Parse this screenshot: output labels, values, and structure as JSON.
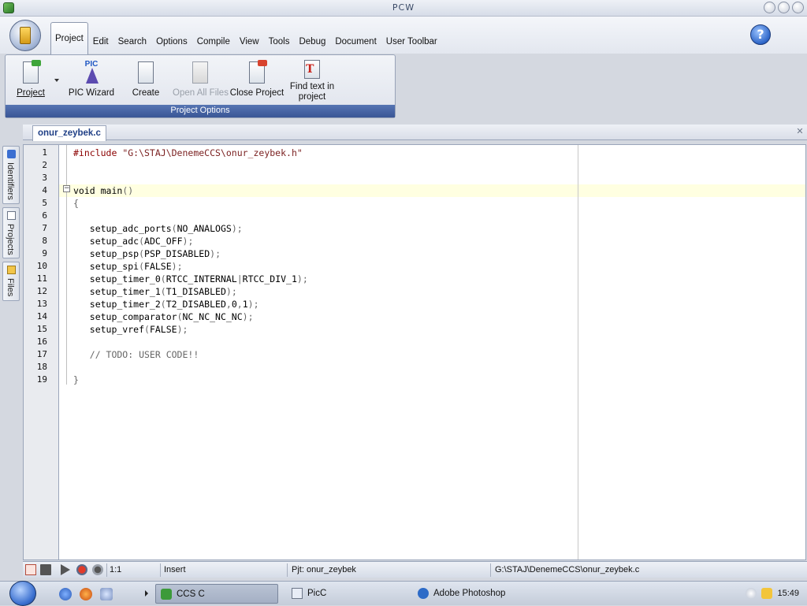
{
  "window": {
    "title": "PCW"
  },
  "menu": {
    "items": [
      "Project",
      "Edit",
      "Search",
      "Options",
      "Compile",
      "View",
      "Tools",
      "Debug",
      "Document",
      "User Toolbar"
    ],
    "active": "Project"
  },
  "ribbon": {
    "buttons": [
      {
        "label": "Project",
        "enabled": true
      },
      {
        "label": "PIC Wizard",
        "enabled": true
      },
      {
        "label": "Create",
        "enabled": true
      },
      {
        "label": "Open All Files",
        "enabled": false
      },
      {
        "label": "Close Project",
        "enabled": true
      },
      {
        "label": "Find text in project",
        "line1": "Find text in",
        "line2": "project",
        "enabled": true
      }
    ],
    "group_label": "Project Options",
    "pic_badge": "PIC"
  },
  "editor": {
    "tab_label": "onur_zeybek.c",
    "current_line": 4,
    "line_numbers": [
      "1",
      "2",
      "3",
      "4",
      "5",
      "6",
      "7",
      "8",
      "9",
      "10",
      "11",
      "12",
      "13",
      "14",
      "15",
      "16",
      "17",
      "18",
      "19"
    ],
    "code": [
      "#include \"G:\\STAJ\\DenemeCCS\\onur_zeybek.h\"",
      "",
      "",
      "void main()",
      "{",
      "",
      "   setup_adc_ports(NO_ANALOGS);",
      "   setup_adc(ADC_OFF);",
      "   setup_psp(PSP_DISABLED);",
      "   setup_spi(FALSE);",
      "   setup_timer_0(RTCC_INTERNAL|RTCC_DIV_1);",
      "   setup_timer_1(T1_DISABLED);",
      "   setup_timer_2(T2_DISABLED,0,1);",
      "   setup_comparator(NC_NC_NC_NC);",
      "   setup_vref(FALSE);",
      "",
      "   // TODO: USER CODE!!",
      "",
      "}"
    ]
  },
  "side_tabs": [
    "Identifiers",
    "Projects",
    "Files"
  ],
  "status": {
    "position": "1:1",
    "mode": "Insert",
    "project": "Pjt: onur_zeybek",
    "path": "G:\\STAJ\\DenemeCCS\\onur_zeybek.c"
  },
  "taskbar": {
    "items": [
      "CCS C",
      "PicC",
      "Adobe Photoshop"
    ],
    "active": "CCS C",
    "clock": "15:49"
  },
  "colors": {
    "accent": "#3a5696",
    "current_line": "#ffffe1",
    "tab_text": "#1f3f86"
  }
}
